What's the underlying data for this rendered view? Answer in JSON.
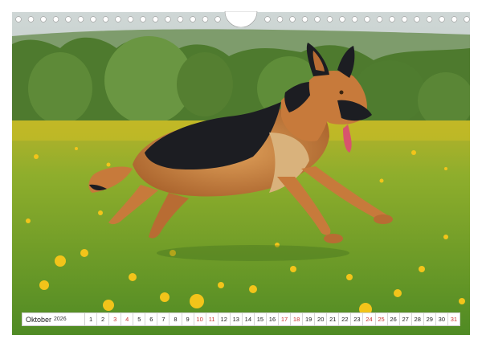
{
  "calendar": {
    "month": "Oktober",
    "year": "2026",
    "days": [
      "1",
      "2",
      "3",
      "4",
      "5",
      "6",
      "7",
      "8",
      "9",
      "10",
      "11",
      "12",
      "13",
      "14",
      "15",
      "16",
      "17",
      "18",
      "19",
      "20",
      "21",
      "22",
      "23",
      "24",
      "25",
      "26",
      "27",
      "28",
      "29",
      "30",
      "31"
    ],
    "weekend_days": [
      "3",
      "4",
      "10",
      "11",
      "17",
      "18",
      "24",
      "25",
      "31"
    ],
    "weekend_color": "#c8352f"
  },
  "photo": {
    "subject": "german-shepherd-running",
    "colors": {
      "sky": "#cfd7d6",
      "trees": "#4e7a2e",
      "grass": "#6fa12e",
      "flowers": "#f2c41a",
      "dog_black": "#1c1d22",
      "dog_tan": "#c77a3b"
    }
  }
}
